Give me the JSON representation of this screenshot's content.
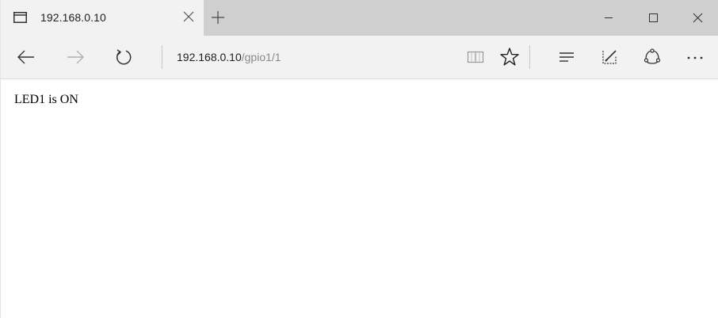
{
  "tab": {
    "title": "192.168.0.10"
  },
  "address_bar": {
    "host": "192.168.0.10",
    "path": "/gpio1/1"
  },
  "page": {
    "text": "LED1 is ON"
  },
  "icons": {
    "tab_favicon": "page-icon",
    "tab_close": "close-icon",
    "new_tab": "plus-icon",
    "minimize": "minimize-icon",
    "maximize": "maximize-icon",
    "close_window": "close-icon",
    "back": "arrow-left-icon",
    "forward": "arrow-right-icon",
    "refresh": "refresh-icon",
    "reading_view": "book-icon",
    "favorites": "star-icon",
    "hub": "hub-icon",
    "web_note": "pen-icon",
    "share": "share-icon",
    "more": "more-icon"
  },
  "colors": {
    "titlebar": "#cfcfcf",
    "active_tab": "#f2f2f2",
    "toolbar": "#f2f2f2",
    "url_path": "#8a8a8a"
  }
}
